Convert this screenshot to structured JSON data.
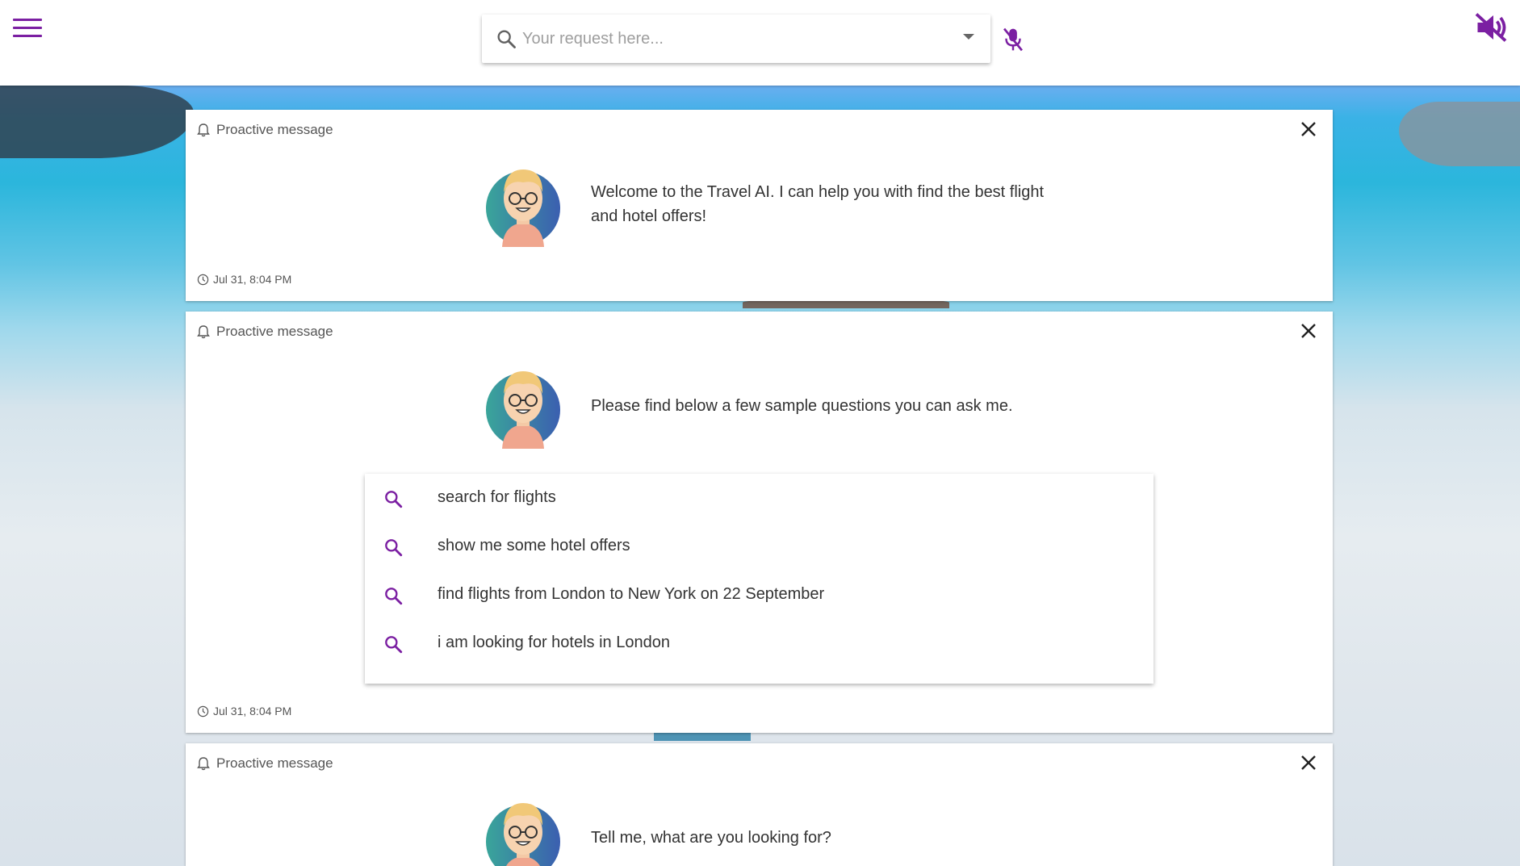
{
  "header": {
    "search_placeholder": "Your request here...",
    "accent_color": "#7b1fa2"
  },
  "icons": {
    "menu": "menu-icon",
    "search": "search-icon",
    "dropdown": "caret-down-icon",
    "mic": "mic-off-icon",
    "volume": "volume-off-icon",
    "bell": "bell-icon",
    "close": "close-icon",
    "clock": "clock-icon"
  },
  "cards": [
    {
      "type_label": "Proactive message",
      "message": "Welcome to the Travel AI. I can help you with find the best flight and hotel offers!",
      "timestamp": "Jul 31, 8:04 PM"
    },
    {
      "type_label": "Proactive message",
      "message": "Please find below a few sample questions you can ask me.",
      "suggestions": [
        "search for flights",
        "show me some hotel offers",
        "find flights from London to New York on 22 September",
        "i am looking for hotels in London"
      ],
      "timestamp": "Jul 31, 8:04 PM"
    },
    {
      "type_label": "Proactive message",
      "message": "Tell me, what are you looking for?"
    }
  ]
}
